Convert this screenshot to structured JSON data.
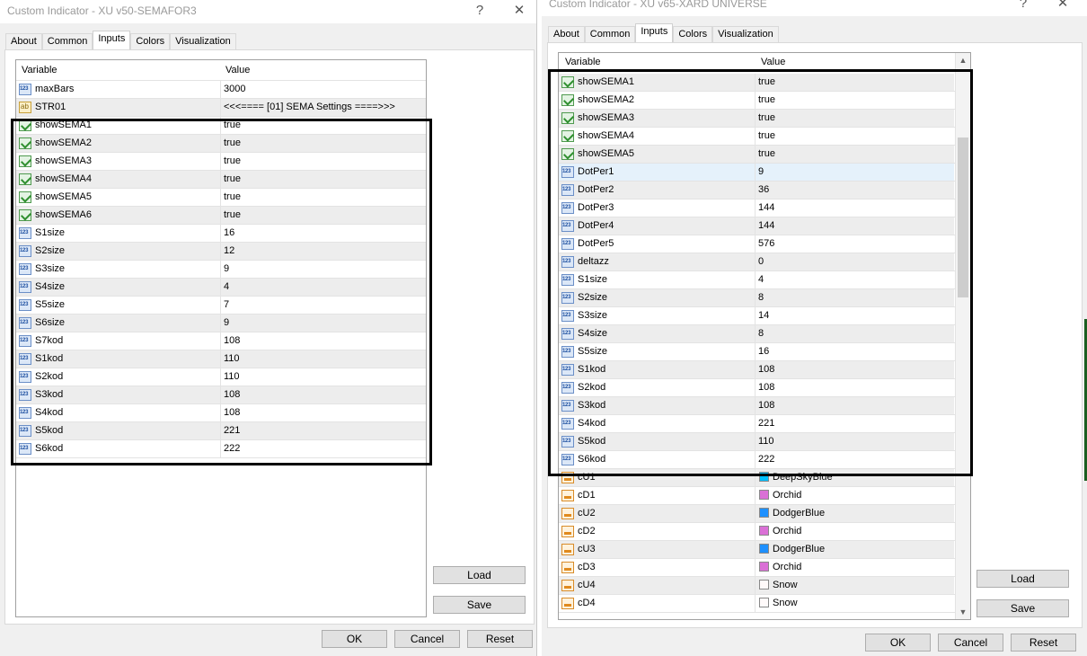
{
  "dialog1": {
    "title": "Custom Indicator - XU v50-SEMAFOR3",
    "title_buttons": {
      "help": "?",
      "close": "✕"
    },
    "tabs": [
      "About",
      "Common",
      "Inputs",
      "Colors",
      "Visualization"
    ],
    "active_tab": "Inputs",
    "columns": {
      "variable": "Variable",
      "value": "Value"
    },
    "rows": [
      {
        "icon": "numeric-icon",
        "name": "maxBars",
        "value": "3000"
      },
      {
        "icon": "string-icon",
        "name": "STR01",
        "value": "<<<==== [01] SEMA Settings ====>>>"
      },
      {
        "icon": "boolean-icon",
        "name": "showSEMA1",
        "value": "true"
      },
      {
        "icon": "boolean-icon",
        "name": "showSEMA2",
        "value": "true"
      },
      {
        "icon": "boolean-icon",
        "name": "showSEMA3",
        "value": "true"
      },
      {
        "icon": "boolean-icon",
        "name": "showSEMA4",
        "value": "true"
      },
      {
        "icon": "boolean-icon",
        "name": "showSEMA5",
        "value": "true"
      },
      {
        "icon": "boolean-icon",
        "name": "showSEMA6",
        "value": "true"
      },
      {
        "icon": "numeric-icon",
        "name": "S1size",
        "value": "16"
      },
      {
        "icon": "numeric-icon",
        "name": "S2size",
        "value": "12"
      },
      {
        "icon": "numeric-icon",
        "name": "S3size",
        "value": "9"
      },
      {
        "icon": "numeric-icon",
        "name": "S4size",
        "value": "4"
      },
      {
        "icon": "numeric-icon",
        "name": "S5size",
        "value": "7"
      },
      {
        "icon": "numeric-icon",
        "name": "S6size",
        "value": "9"
      },
      {
        "icon": "numeric-icon",
        "name": "S7kod",
        "value": "108"
      },
      {
        "icon": "numeric-icon",
        "name": "S1kod",
        "value": "110"
      },
      {
        "icon": "numeric-icon",
        "name": "S2kod",
        "value": "110"
      },
      {
        "icon": "numeric-icon",
        "name": "S3kod",
        "value": "108"
      },
      {
        "icon": "numeric-icon",
        "name": "S4kod",
        "value": "108"
      },
      {
        "icon": "numeric-icon",
        "name": "S5kod",
        "value": "221"
      },
      {
        "icon": "numeric-icon",
        "name": "S6kod",
        "value": "222"
      }
    ],
    "buttons": {
      "load": "Load",
      "save": "Save",
      "ok": "OK",
      "cancel": "Cancel",
      "reset": "Reset"
    }
  },
  "dialog2": {
    "title": "Custom Indicator - XU v65-XARD UNIVERSE",
    "title_buttons": {
      "help": "?",
      "close": "✕"
    },
    "tabs": [
      "About",
      "Common",
      "Inputs",
      "Colors",
      "Visualization"
    ],
    "active_tab": "Inputs",
    "columns": {
      "variable": "Variable",
      "value": "Value"
    },
    "selected_row": "DotPer1",
    "rows": [
      {
        "icon": "boolean-icon",
        "name": "showSEMA1",
        "value": "true"
      },
      {
        "icon": "boolean-icon",
        "name": "showSEMA2",
        "value": "true"
      },
      {
        "icon": "boolean-icon",
        "name": "showSEMA3",
        "value": "true"
      },
      {
        "icon": "boolean-icon",
        "name": "showSEMA4",
        "value": "true"
      },
      {
        "icon": "boolean-icon",
        "name": "showSEMA5",
        "value": "true"
      },
      {
        "icon": "numeric-icon",
        "name": "DotPer1",
        "value": "9"
      },
      {
        "icon": "numeric-icon",
        "name": "DotPer2",
        "value": "36"
      },
      {
        "icon": "numeric-icon",
        "name": "DotPer3",
        "value": "144"
      },
      {
        "icon": "numeric-icon",
        "name": "DotPer4",
        "value": "144"
      },
      {
        "icon": "numeric-icon",
        "name": "DotPer5",
        "value": "576"
      },
      {
        "icon": "numeric-icon",
        "name": "deltazz",
        "value": "0"
      },
      {
        "icon": "numeric-icon",
        "name": "S1size",
        "value": "4"
      },
      {
        "icon": "numeric-icon",
        "name": "S2size",
        "value": "8"
      },
      {
        "icon": "numeric-icon",
        "name": "S3size",
        "value": "14"
      },
      {
        "icon": "numeric-icon",
        "name": "S4size",
        "value": "8"
      },
      {
        "icon": "numeric-icon",
        "name": "S5size",
        "value": "16"
      },
      {
        "icon": "numeric-icon",
        "name": "S1kod",
        "value": "108"
      },
      {
        "icon": "numeric-icon",
        "name": "S2kod",
        "value": "108"
      },
      {
        "icon": "numeric-icon",
        "name": "S3kod",
        "value": "108"
      },
      {
        "icon": "numeric-icon",
        "name": "S4kod",
        "value": "221"
      },
      {
        "icon": "numeric-icon",
        "name": "S5kod",
        "value": "110"
      },
      {
        "icon": "numeric-icon",
        "name": "S6kod",
        "value": "222"
      },
      {
        "icon": "color-icon",
        "name": "cU1",
        "value": "DeepSkyBlue",
        "color": "#00bfff"
      },
      {
        "icon": "color-icon",
        "name": "cD1",
        "value": "Orchid",
        "color": "#da70d6"
      },
      {
        "icon": "color-icon",
        "name": "cU2",
        "value": "DodgerBlue",
        "color": "#1e90ff"
      },
      {
        "icon": "color-icon",
        "name": "cD2",
        "value": "Orchid",
        "color": "#da70d6"
      },
      {
        "icon": "color-icon",
        "name": "cU3",
        "value": "DodgerBlue",
        "color": "#1e90ff"
      },
      {
        "icon": "color-icon",
        "name": "cD3",
        "value": "Orchid",
        "color": "#da70d6"
      },
      {
        "icon": "color-icon",
        "name": "cU4",
        "value": "Snow",
        "color": "#fffafa"
      },
      {
        "icon": "color-icon",
        "name": "cD4",
        "value": "Snow",
        "color": "#fffafa"
      }
    ],
    "scrollbar": {
      "up": "▲",
      "down": "▼"
    },
    "buttons": {
      "load": "Load",
      "save": "Save",
      "ok": "OK",
      "cancel": "Cancel",
      "reset": "Reset"
    }
  },
  "highlight_color": "#000000"
}
